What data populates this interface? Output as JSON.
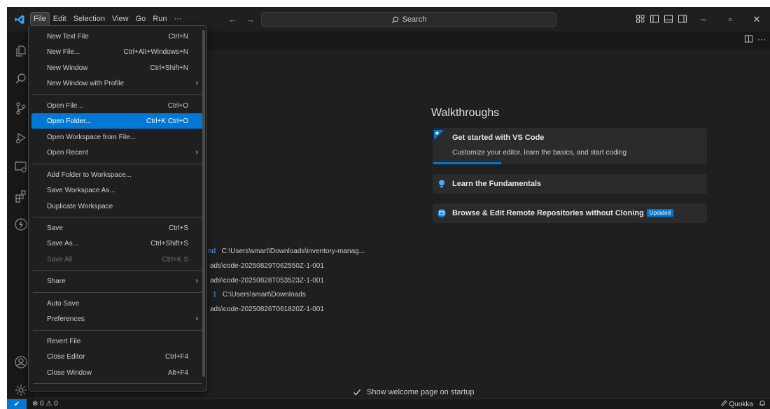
{
  "menubar": {
    "items": [
      "File",
      "Edit",
      "Selection",
      "View",
      "Go",
      "Run",
      "···"
    ]
  },
  "search": {
    "label": "Search"
  },
  "nav": {
    "back": "←",
    "forward": "→"
  },
  "window_controls": {
    "minimize": "–",
    "restore": "▫",
    "close": "✕"
  },
  "file_menu": {
    "items": [
      {
        "label": "New Text File",
        "shortcut": "Ctrl+N"
      },
      {
        "label": "New File...",
        "shortcut": "Ctrl+Alt+Windows+N"
      },
      {
        "label": "New Window",
        "shortcut": "Ctrl+Shift+N"
      },
      {
        "label": "New Window with Profile",
        "shortcut": ""
      },
      {
        "label": "Open File...",
        "shortcut": "Ctrl+O"
      },
      {
        "label": "Open Folder...",
        "shortcut": "Ctrl+K Ctrl+O"
      },
      {
        "label": "Open Workspace from File...",
        "shortcut": ""
      },
      {
        "label": "Open Recent",
        "shortcut": ""
      },
      {
        "label": "Add Folder to Workspace...",
        "shortcut": ""
      },
      {
        "label": "Save Workspace As...",
        "shortcut": ""
      },
      {
        "label": "Duplicate Workspace",
        "shortcut": ""
      },
      {
        "label": "Save",
        "shortcut": "Ctrl+S"
      },
      {
        "label": "Save As...",
        "shortcut": "Ctrl+Shift+S"
      },
      {
        "label": "Save All",
        "shortcut": "Ctrl+K S"
      },
      {
        "label": "Share",
        "shortcut": ""
      },
      {
        "label": "Auto Save",
        "shortcut": ""
      },
      {
        "label": "Preferences",
        "shortcut": ""
      },
      {
        "label": "Revert File",
        "shortcut": ""
      },
      {
        "label": "Close Editor",
        "shortcut": "Ctrl+F4"
      },
      {
        "label": "Close Window",
        "shortcut": "Alt+F4"
      }
    ]
  },
  "recent": [
    {
      "link": "nd",
      "path": "C:\\Users\\smart\\Downloads\\inventory-manag..."
    },
    {
      "link": "",
      "path": "ads\\code-20250829T062550Z-1-001"
    },
    {
      "link": "",
      "path": "ads\\code-20250828T053523Z-1-001"
    },
    {
      "link": "1",
      "path": "C:\\Users\\smart\\Downloads"
    },
    {
      "link": "",
      "path": "ads\\code-20250826T061820Z-1-001"
    }
  ],
  "walkthroughs": {
    "title": "Walkthroughs",
    "cards": [
      {
        "title": "Get started with VS Code",
        "desc": "Customize your editor, learn the basics, and start coding",
        "progress": 0.25
      },
      {
        "title": "Learn the Fundamentals",
        "desc": ""
      },
      {
        "title": "Browse & Edit Remote Repositories without Cloning",
        "badge": "Updated",
        "desc": ""
      }
    ]
  },
  "startup": {
    "label": "Show welcome page on startup",
    "checked": true
  },
  "statusbar": {
    "remote": "✔",
    "problems": "⊗ 0 ⚠ 0",
    "quokka": "Quokka"
  },
  "colors": {
    "accent": "#0078d4",
    "link": "#4daafc",
    "background": "#1f1f1f",
    "activitybar": "#181818"
  }
}
